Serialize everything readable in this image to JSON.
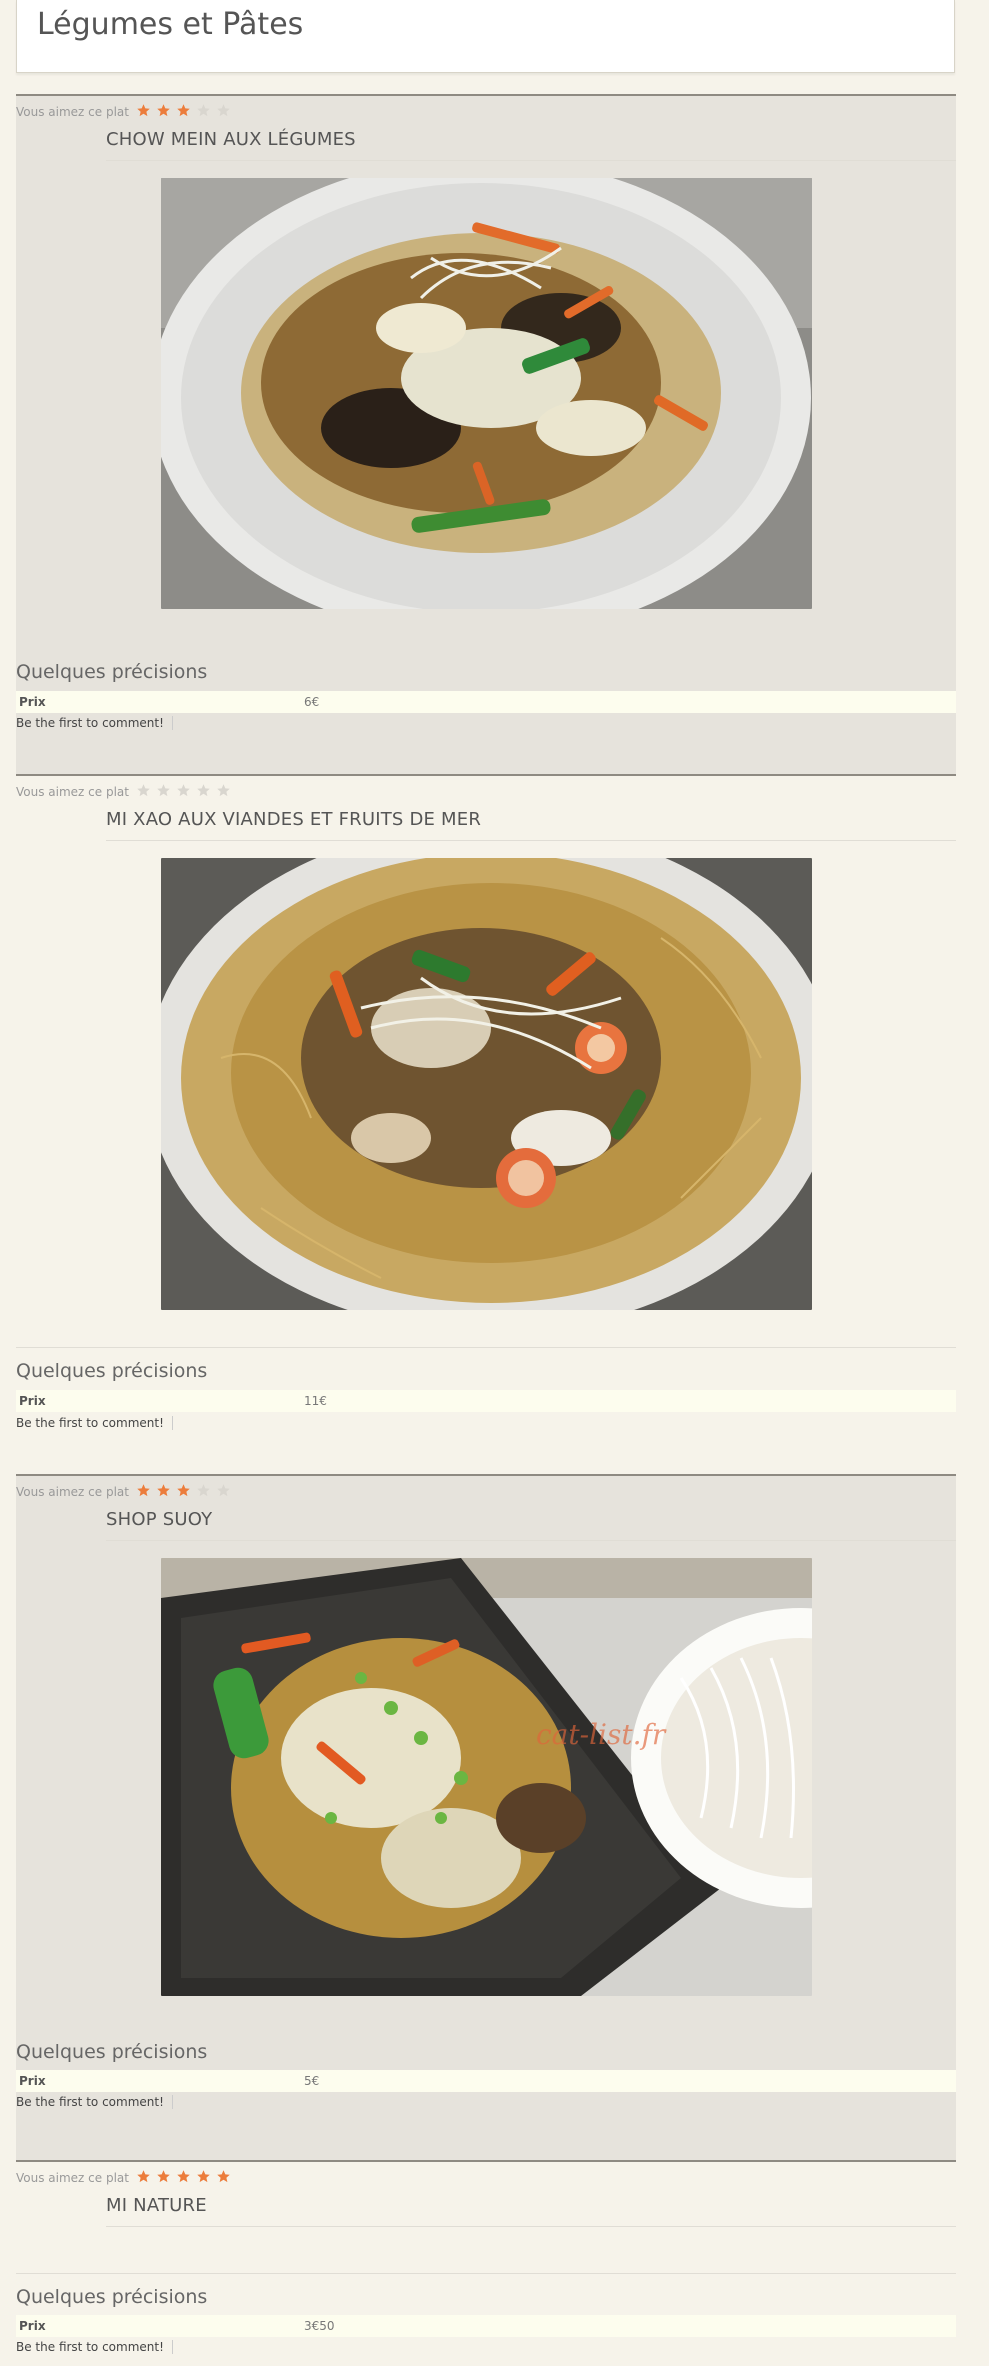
{
  "category": {
    "title": "Légumes et Pâtes"
  },
  "labels": {
    "rating": "Vous aimez ce plat",
    "details": "Quelques précisions",
    "price_key": "Prix",
    "comment": "Be the first to comment!"
  },
  "colors": {
    "star_on": "#ec7d3c",
    "star_off": "#d9d6cf",
    "rule": "#8e8a82",
    "row_bg": "#fdfdee"
  },
  "dishes": [
    {
      "name": "CHOW MEIN AUX LÉGUMES",
      "rating": 3,
      "rating_max": 5,
      "price": "6€",
      "photo": "stir-fried-vegetable-noodles"
    },
    {
      "name": "MI XAO AUX VIANDES ET FRUITS DE MER",
      "rating": 0,
      "rating_max": 5,
      "price": "11€",
      "photo": "crispy-noodles-seafood"
    },
    {
      "name": "SHOP SUOY",
      "rating": 3,
      "rating_max": 5,
      "price": "5€",
      "photo": "chop-suey-platter",
      "watermark": "cat-list.fr"
    },
    {
      "name": "MI NATURE",
      "rating": 5,
      "rating_max": 5,
      "price": "3€50"
    }
  ]
}
